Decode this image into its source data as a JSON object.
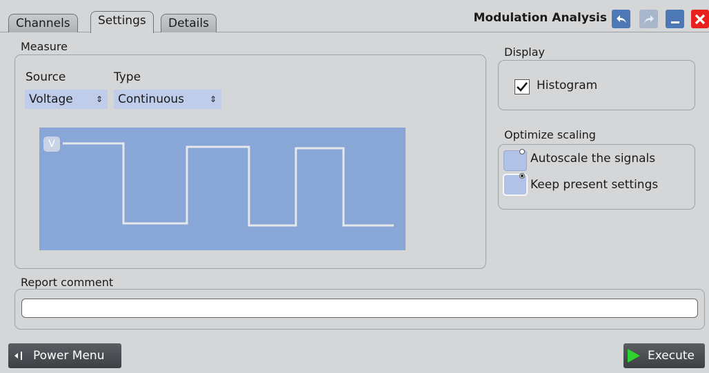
{
  "tabs": [
    {
      "label": "Channels",
      "active": false
    },
    {
      "label": "Settings",
      "active": true
    },
    {
      "label": "Details",
      "active": false
    }
  ],
  "window": {
    "title": "Modulation Analysis"
  },
  "measure": {
    "group_label": "Measure",
    "source_label": "Source",
    "source_value": "Voltage",
    "type_label": "Type",
    "type_value": "Continuous",
    "waveform_badge": "V"
  },
  "display": {
    "group_label": "Display",
    "histogram_label": "Histogram",
    "histogram_checked": true
  },
  "optimize": {
    "group_label": "Optimize scaling",
    "options": [
      {
        "label": "Autoscale the signals",
        "selected": false
      },
      {
        "label": "Keep present settings",
        "selected": true
      }
    ]
  },
  "report": {
    "label": "Report comment",
    "value": ""
  },
  "footer": {
    "power_menu": "Power Menu",
    "execute": "Execute"
  },
  "colors": {
    "accent_waveform_bg": "#88a6d6",
    "close": "#e8211d",
    "action_blue": "#5f88c4",
    "execute_arrow": "#2dd42d"
  }
}
